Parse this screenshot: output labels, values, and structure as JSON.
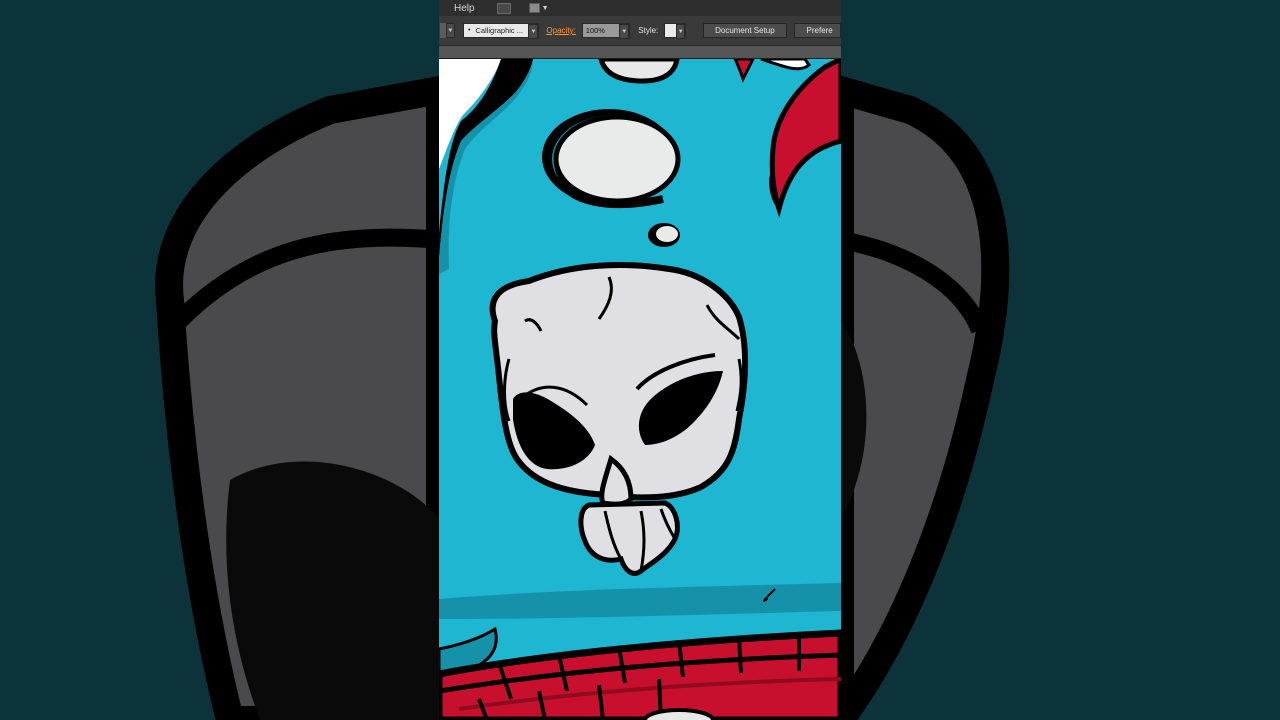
{
  "menubar": {
    "help_label": "Help",
    "icons": [
      "bridge-icon",
      "workspace-switcher-icon"
    ]
  },
  "controlbar": {
    "brush": {
      "value": "Calligraphic ...",
      "icon": "brush-dot-icon"
    },
    "opacity": {
      "label": "Opacity:",
      "value": "100%"
    },
    "style": {
      "label": "Style:"
    },
    "document_setup_label": "Document Setup",
    "preferences_label": "Prefere"
  },
  "colors": {
    "canvas_bg": "#1fb6d2",
    "shadow": "#1592aa",
    "skull": "#e0dfe3",
    "outline": "#000000",
    "red": "#c8102e",
    "highlight": "#e8e8e8",
    "link_orange": "#ff9a2c"
  }
}
